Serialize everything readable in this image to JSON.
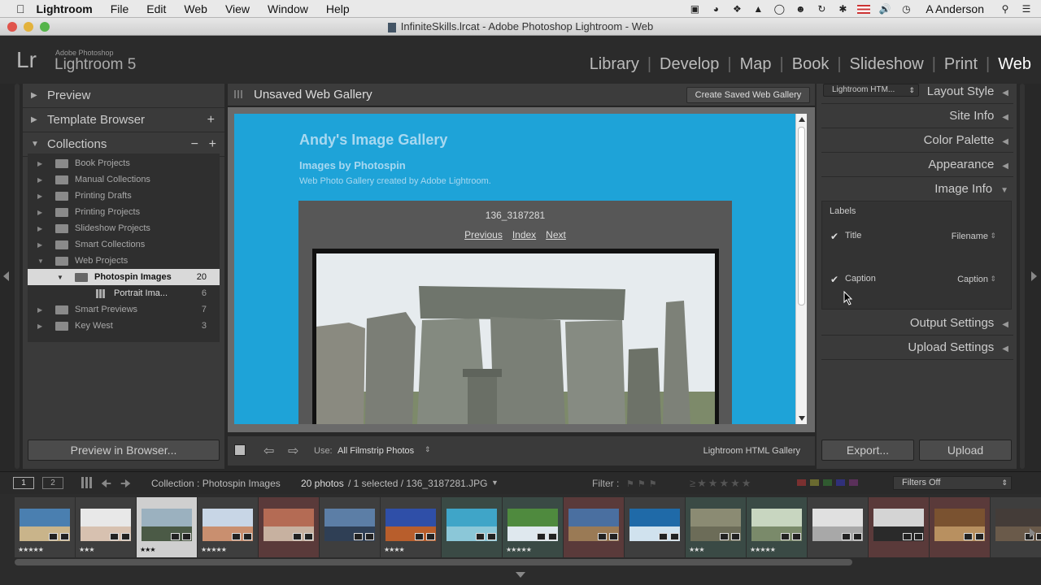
{
  "menubar": {
    "app": "Lightroom",
    "items": [
      "File",
      "Edit",
      "Web",
      "View",
      "Window",
      "Help"
    ],
    "user": "A Anderson"
  },
  "window": {
    "title": "InfiniteSkills.lrcat - Adobe Photoshop Lightroom - Web"
  },
  "identity": {
    "logo": "Lr",
    "sub": "Adobe Photoshop",
    "name": "Lightroom 5"
  },
  "modules": [
    "Library",
    "Develop",
    "Map",
    "Book",
    "Slideshow",
    "Print",
    "Web"
  ],
  "left": {
    "preview": "Preview",
    "template_browser": "Template Browser",
    "collections": "Collections",
    "items": [
      {
        "label": "Book Projects",
        "count": ""
      },
      {
        "label": "Manual Collections",
        "count": ""
      },
      {
        "label": "Printing Drafts",
        "count": ""
      },
      {
        "label": "Printing Projects",
        "count": ""
      },
      {
        "label": "Slideshow Projects",
        "count": ""
      },
      {
        "label": "Smart Collections",
        "count": ""
      },
      {
        "label": "Web Projects",
        "count": ""
      },
      {
        "label": "Photospin Images",
        "count": "20"
      },
      {
        "label": "Portrait Ima...",
        "count": "6"
      },
      {
        "label": "Smart Previews",
        "count": "7"
      },
      {
        "label": "Key West",
        "count": "3"
      }
    ],
    "preview_button": "Preview in Browser..."
  },
  "center": {
    "title": "Unsaved Web Gallery",
    "create_button": "Create Saved Web Gallery",
    "site_title": "Andy's Image Gallery",
    "site_subtitle": "Images by Photospin",
    "site_desc": "Web Photo Gallery created by Adobe Lightroom.",
    "photo_name": "136_3187281",
    "nav": {
      "prev": "Previous",
      "index": "Index",
      "next": "Next"
    },
    "use_label": "Use:",
    "use_value": "All Filmstrip Photos",
    "engine": "Lightroom HTML Gallery"
  },
  "right": {
    "engine_select": "Lightroom HTM...",
    "panels": [
      "Layout Style",
      "Site Info",
      "Color Palette",
      "Appearance",
      "Image Info",
      "Output Settings",
      "Upload Settings"
    ],
    "labels_heading": "Labels",
    "title_label": "Title",
    "title_value": "Filename",
    "caption_label": "Caption",
    "caption_value": "Caption",
    "export_button": "Export...",
    "upload_button": "Upload"
  },
  "filmbar": {
    "page1": "1",
    "page2": "2",
    "source": "Collection : Photospin Images",
    "count": "20 photos",
    "selection": "/ 1 selected / 136_3187281.JPG",
    "filter_label": "Filter :",
    "filter_value": "Filters Off"
  },
  "filmstrip": {
    "thumbs": [
      {
        "stars": "★★★★★",
        "c1": "#4a7fb0",
        "c2": "#c9b48a",
        "bg": "#3e3e3e"
      },
      {
        "stars": "★★★",
        "c1": "#e8e8e8",
        "c2": "#d7c1b0",
        "bg": "#3e3e3e"
      },
      {
        "stars": "★★★",
        "c1": "#9bb1bf",
        "c2": "#4b5a46",
        "bg": "#cfcfcf"
      },
      {
        "stars": "★★★★★",
        "c1": "#c8d6e6",
        "c2": "#c98f6f",
        "bg": "#3e3e3e"
      },
      {
        "stars": "",
        "c1": "#b46b54",
        "c2": "#c7b1a0",
        "bg": "#5a3a3a"
      },
      {
        "stars": "",
        "c1": "#5c7ea6",
        "c2": "#2f3f55",
        "bg": "#3e3e3e"
      },
      {
        "stars": "★★★★",
        "c1": "#2f4fa8",
        "c2": "#b85e2c",
        "bg": "#3e3e3e"
      },
      {
        "stars": "",
        "c1": "#3fa5c8",
        "c2": "#8bc7d8",
        "bg": "#3a4a45"
      },
      {
        "stars": "★★★★★",
        "c1": "#4f8a3e",
        "c2": "#dfe8ee",
        "bg": "#3a4a45"
      },
      {
        "stars": "",
        "c1": "#4a6fa0",
        "c2": "#9a7a55",
        "bg": "#5a3a3a"
      },
      {
        "stars": "",
        "c1": "#1f6aa8",
        "c2": "#d0e2ee",
        "bg": "#3e3e3e"
      },
      {
        "stars": "★★★",
        "c1": "#8b8b73",
        "c2": "#6c6c58",
        "bg": "#3a4a45"
      },
      {
        "stars": "★★★★★",
        "c1": "#c8d6c0",
        "c2": "#7a8a6a",
        "bg": "#3a4a45"
      },
      {
        "stars": "",
        "c1": "#e0e0e0",
        "c2": "#a8a8a8",
        "bg": "#3e3e3e"
      },
      {
        "stars": "",
        "c1": "#d4d4d4",
        "c2": "#2a2a2a",
        "bg": "#5a3a3a"
      },
      {
        "stars": "",
        "c1": "#7a5230",
        "c2": "#b89060",
        "bg": "#5a3a3a"
      },
      {
        "stars": "",
        "c1": "#443c38",
        "c2": "#6a5a4a",
        "bg": "#3e3e3e"
      }
    ]
  }
}
